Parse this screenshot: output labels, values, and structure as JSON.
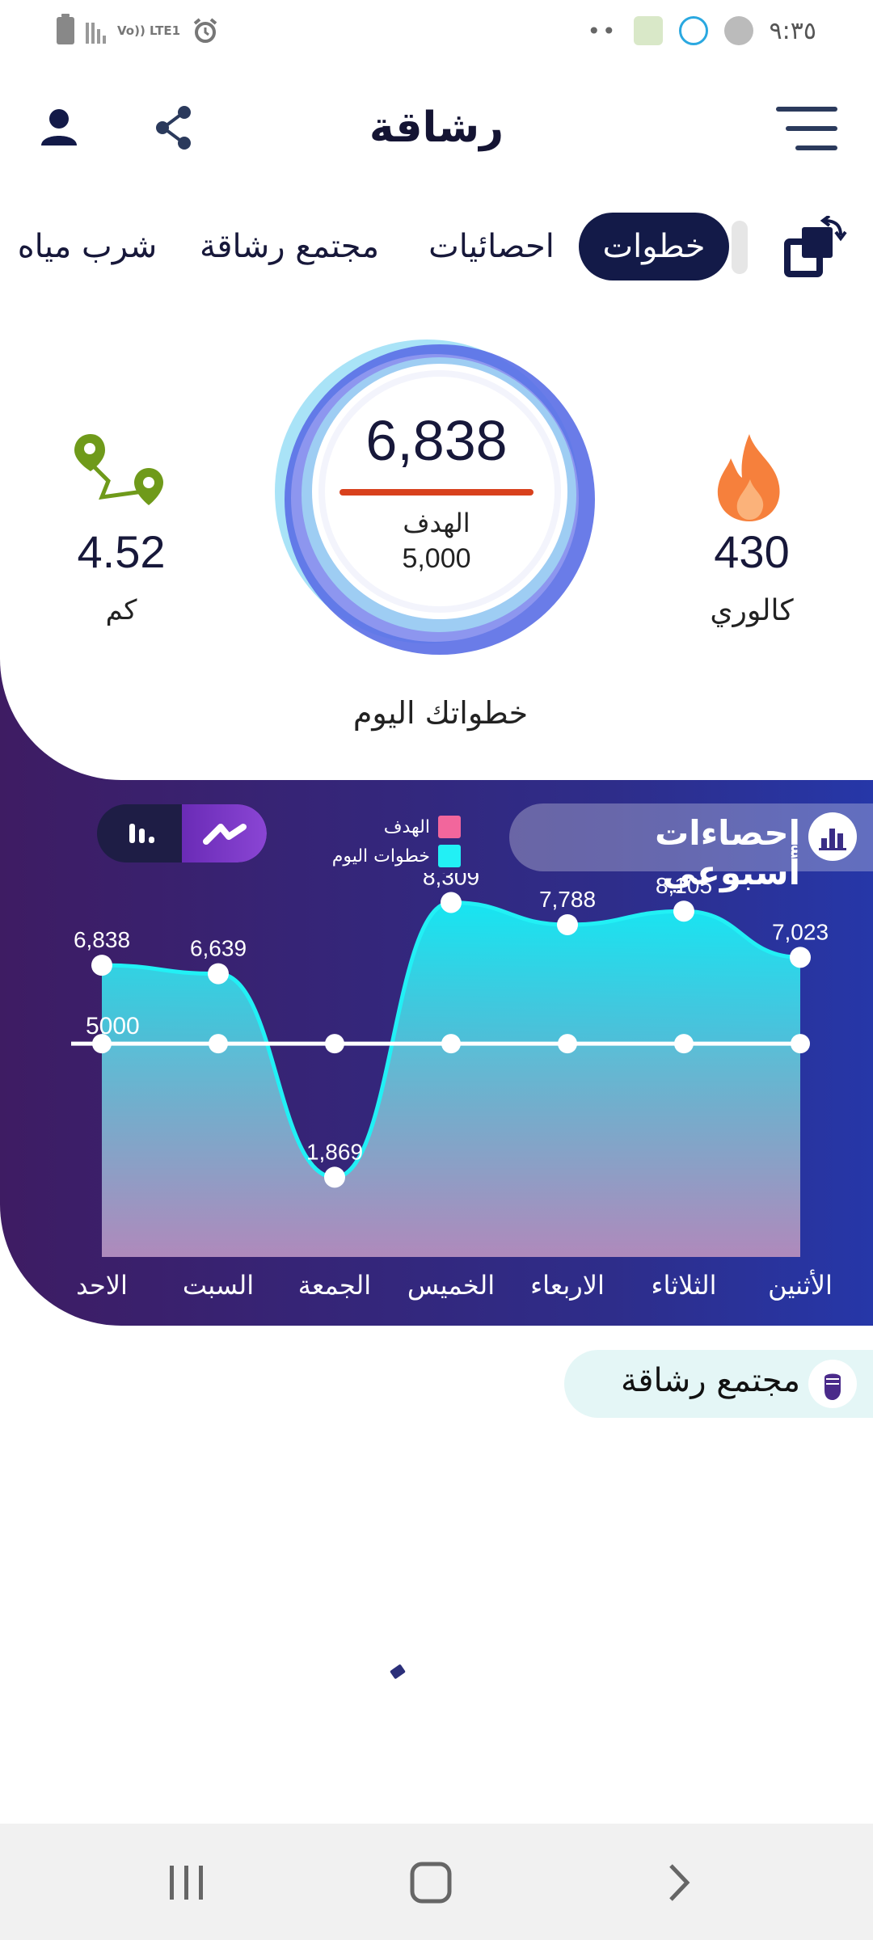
{
  "status_bar": {
    "time": "٩:٣٥",
    "network_label": "Vo)) LTE1",
    "notification_dots": "••"
  },
  "app": {
    "title": "رشاقة"
  },
  "tabs": [
    {
      "label": "خطوات",
      "active": true
    },
    {
      "label": "احصائيات",
      "active": false
    },
    {
      "label": "مجتمع رشاقة",
      "active": false
    },
    {
      "label": "شرب مياه",
      "active": false
    }
  ],
  "summary": {
    "steps": "6,838",
    "goal_label": "الهدف",
    "goal_value": "5,000",
    "today_label": "خطواتك اليوم",
    "distance_value": "4.52",
    "distance_unit": "كم",
    "calories_value": "430",
    "calories_unit": "كالوري"
  },
  "weekly": {
    "title": "إحصاءات أسبوعي",
    "legend": [
      {
        "label": "الهدف",
        "color": "#f2669c"
      },
      {
        "label": "خطوات اليوم",
        "color": "#22f0f5"
      }
    ]
  },
  "chart_data": {
    "type": "area",
    "categories": [
      "الأثنين",
      "الثلاثاء",
      "الاربعاء",
      "الخميس",
      "الجمعة",
      "السبت",
      "الاحد"
    ],
    "series": [
      {
        "name": "خطوات اليوم",
        "values": [
          7023,
          8105,
          7788,
          8309,
          1869,
          6639,
          6838
        ],
        "labels": [
          "7,023",
          "8,105",
          "7,788",
          "8,309",
          "1,869",
          "6,639",
          "6,838"
        ],
        "color": "#22f0f5"
      },
      {
        "name": "الهدف",
        "values": [
          5000,
          5000,
          5000,
          5000,
          5000,
          5000,
          5000
        ],
        "color": "#f2669c"
      }
    ],
    "goal_line_label": "5000",
    "ylim": [
      0,
      9000
    ]
  },
  "community": {
    "title": "مجتمع رشاقة"
  },
  "colors": {
    "primary": "#131a48",
    "accent_cyan": "#22f0f5",
    "accent_pink": "#f2669c",
    "progress_red": "#d8411d",
    "fire_orange": "#f6803c",
    "pin_green": "#6f9a1a"
  }
}
